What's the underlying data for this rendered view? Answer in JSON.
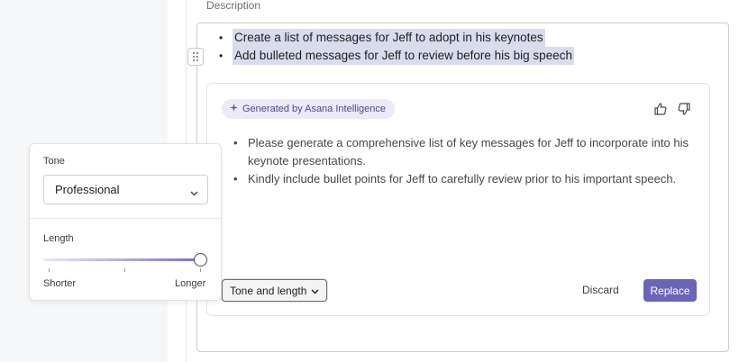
{
  "description": {
    "label": "Description"
  },
  "editor": {
    "bullets": [
      {
        "text": "Create a list of messages for Jeff to adopt in his keynotes"
      },
      {
        "text": "Add bulleted messages for Jeff to review before his big speech"
      }
    ]
  },
  "ai_card": {
    "badge": "Generated by Asana Intelligence",
    "items": [
      {
        "text": "Please generate a comprehensive list of key messages for Jeff to incorporate into his keynote presentations."
      },
      {
        "text": "Kindly include bullet points for Jeff to carefully review prior to his important speech."
      }
    ],
    "tone_length_button": "Tone and length",
    "discard_button": "Discard",
    "replace_button": "Replace"
  },
  "popover": {
    "tone_label": "Tone",
    "tone_value": "Professional",
    "length_label": "Length",
    "length_min_label": "Shorter",
    "length_max_label": "Longer",
    "length_level": 1.0
  },
  "colors": {
    "accent": "#6c64b8",
    "highlight": "#d8dcec",
    "badge_bg": "#eceaf7"
  },
  "icons": {
    "sparkle": "sparkle-icon",
    "thumbs_up": "thumbs-up-icon",
    "thumbs_down": "thumbs-down-icon",
    "chevron": "chevron-down-icon",
    "drag": "drag-handle-icon"
  }
}
